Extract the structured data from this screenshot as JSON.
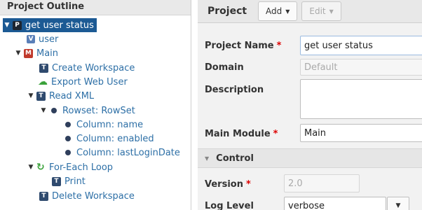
{
  "outline": {
    "title": "Project Outline",
    "nodes": [
      {
        "label": "get user status",
        "icon": "P"
      },
      {
        "label": "user",
        "icon": "V"
      },
      {
        "label": "Main",
        "icon": "M"
      },
      {
        "label": "Create Workspace",
        "icon": "T"
      },
      {
        "label": "Export Web User",
        "icon": "cloud"
      },
      {
        "label": "Read XML",
        "icon": "T"
      },
      {
        "label": "Rowset: RowSet",
        "icon": "bullet"
      },
      {
        "label": "Column: name",
        "icon": "bullet"
      },
      {
        "label": "Column: enabled",
        "icon": "bullet"
      },
      {
        "label": "Column: lastLoginDate",
        "icon": "bullet"
      },
      {
        "label": "For-Each Loop",
        "icon": "loop"
      },
      {
        "label": "Print",
        "icon": "T"
      },
      {
        "label": "Delete Workspace",
        "icon": "T"
      }
    ]
  },
  "toolbar": {
    "title": "Project",
    "add_label": "Add",
    "edit_label": "Edit"
  },
  "form": {
    "project_name_label": "Project Name",
    "project_name_value": "get user status",
    "domain_label": "Domain",
    "domain_placeholder": "Default",
    "description_label": "Description",
    "description_value": "",
    "main_module_label": "Main Module",
    "main_module_value": "Main",
    "required_mark": "*"
  },
  "control": {
    "section_title": "Control",
    "version_label": "Version",
    "version_placeholder": "2.0",
    "log_level_label": "Log Level",
    "log_level_value": "verbose"
  },
  "colors": {
    "selection": "#1c5a94",
    "link": "#2d6fa6",
    "required": "#dd0000"
  }
}
